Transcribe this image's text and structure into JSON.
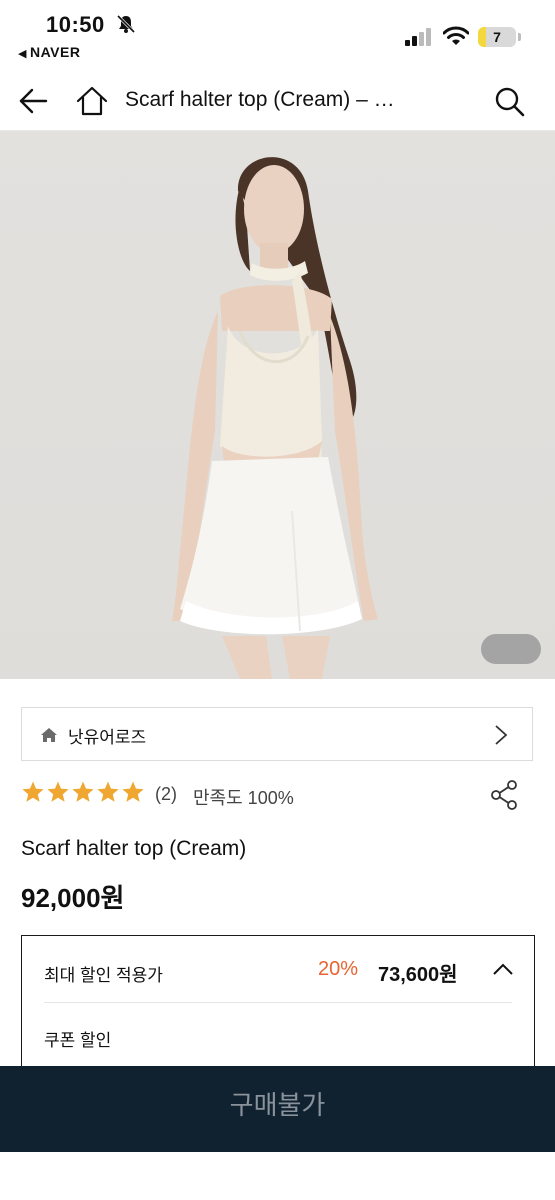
{
  "status_bar": {
    "time": "10:50",
    "back_app": "NAVER",
    "battery_level": "7",
    "battery_fraction": 0.2
  },
  "nav": {
    "title": "Scarf halter top (Cream) – …"
  },
  "store": {
    "name": "낫유어로즈"
  },
  "rating": {
    "stars": 5,
    "review_count": "(2)",
    "satisfaction": "만족도 100%"
  },
  "product": {
    "name": "Scarf halter top (Cream)",
    "price": "92,000원"
  },
  "discount": {
    "label": "최대 할인 적용가",
    "percent": "20%",
    "price": "73,600원",
    "coupon_label": "쿠폰 할인"
  },
  "buy": {
    "label": "구매불가"
  },
  "colors": {
    "accent_discount": "#e8632f",
    "star": "#f0a732",
    "buy_bar": "#102130"
  }
}
